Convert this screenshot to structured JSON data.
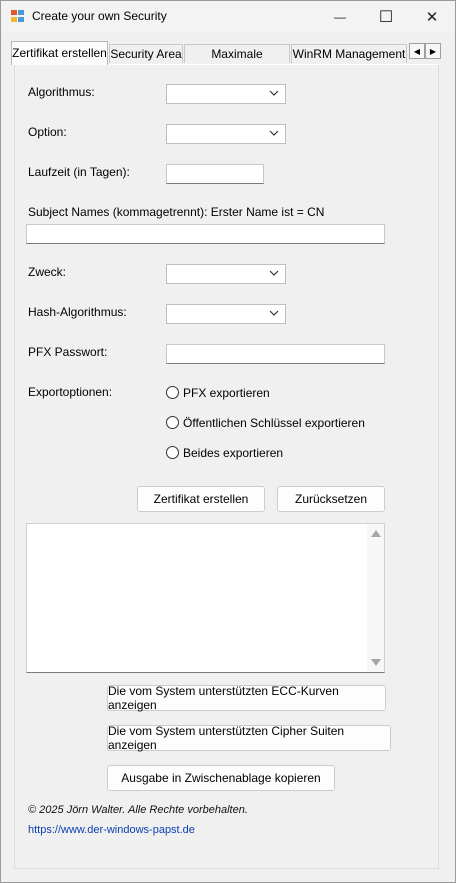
{
  "window": {
    "title": "Create your own Security",
    "minimize_glyph": "—",
    "maximize_glyph": "☐",
    "close_glyph": "✕"
  },
  "tabs": [
    {
      "label": "Zertifikat erstellen",
      "active": true
    },
    {
      "label": "Security Area",
      "active": false
    },
    {
      "label": "Maximale Sicherheit",
      "active": false
    },
    {
      "label": "WinRM Management",
      "active": false
    }
  ],
  "tab_scroll": {
    "left_glyph": "◀",
    "right_glyph": "▶"
  },
  "form": {
    "algorithm_label": "Algorithmus:",
    "option_label": "Option:",
    "validity_label": "Laufzeit (in Tagen):",
    "subject_label": "Subject Names (kommagetrennt): Erster Name ist = CN",
    "purpose_label": "Zweck:",
    "hash_label": "Hash-Algorithmus:",
    "pfx_password_label": "PFX Passwort:",
    "export_label": "Exportoptionen:",
    "export_options": [
      "PFX exportieren",
      "Öffentlichen Schlüssel exportieren",
      "Beides exportieren"
    ]
  },
  "buttons": {
    "create": "Zertifikat erstellen",
    "reset": "Zurücksetzen",
    "ecc_curves": "Die vom System unterstützten ECC-Kurven anzeigen",
    "cipher_suites": "Die vom System unterstützten Cipher Suiten anzeigen",
    "copy_clipboard": "Ausgabe in Zwischenablage kopieren"
  },
  "footer": {
    "copyright": "© 2025 Jörn Walter. Alle Rechte vorbehalten.",
    "link": "https://www.der-windows-papst.de"
  },
  "icons": {
    "app": "app-window-icon",
    "dropdown": "chevron-down-icon"
  },
  "colors": {
    "link": "#0b3fb2",
    "background": "#f0f0f0"
  }
}
